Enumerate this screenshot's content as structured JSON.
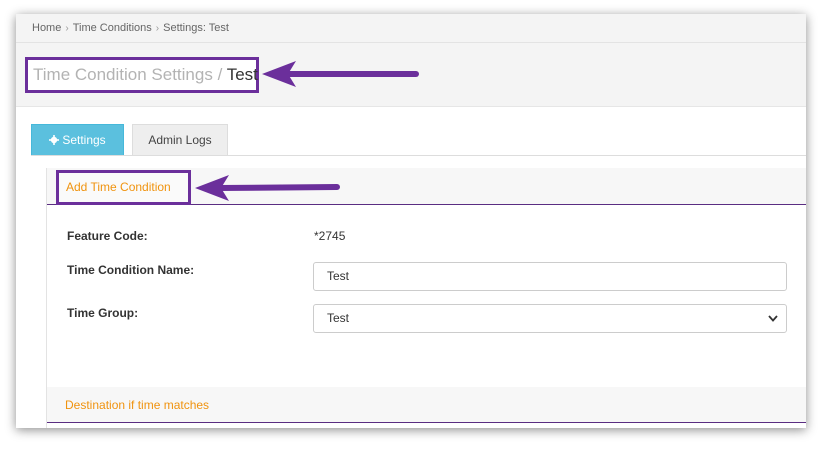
{
  "breadcrumb": {
    "items": [
      "Home",
      "Time Conditions",
      "Settings: Test"
    ],
    "separator": "›"
  },
  "page": {
    "title_prefix": "Time Condition Settings / ",
    "title_name": "Test"
  },
  "tabs": [
    {
      "label": "Settings",
      "icon": "gear-icon",
      "active": true
    },
    {
      "label": "Admin Logs",
      "active": false
    }
  ],
  "section1": {
    "title": "Add Time Condition",
    "fields": {
      "feature_code_label": "Feature Code:",
      "feature_code_value": "*2745",
      "name_label": "Time Condition Name:",
      "name_value": "Test",
      "group_label": "Time Group:",
      "group_value": "Test"
    }
  },
  "section2": {
    "title": "Destination if time matches"
  },
  "colors": {
    "accent_orange": "#f0930f",
    "annotation_purple": "#6b2f9b",
    "tab_active": "#5bc0de"
  }
}
